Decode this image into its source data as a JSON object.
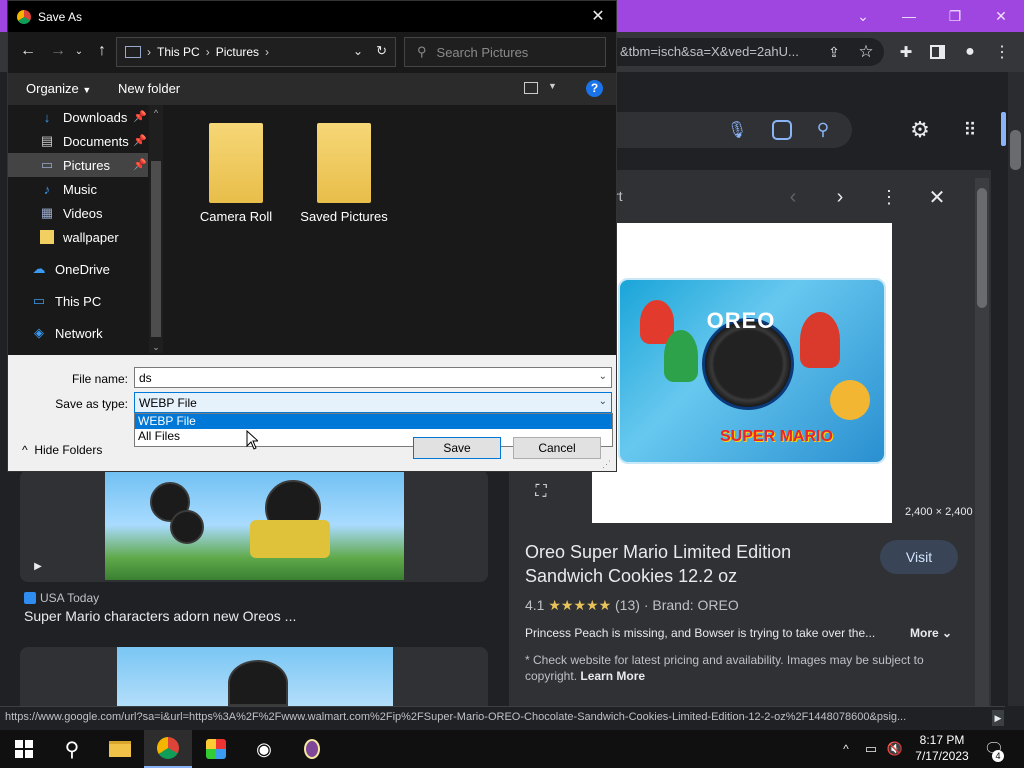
{
  "browser": {
    "omnibox_text": "&tbm=isch&sa=X&ved=2ahU...",
    "status_url": "https://www.google.com/url?sa=i&url=https%3A%2F%2Fwww.walmart.com%2Fip%2FSuper-Mario-OREO-Chocolate-Sandwich-Cookies-Limited-Edition-12-2-oz%2F1448078600&psig..."
  },
  "panel": {
    "header_partial": "rt",
    "image_size": "2,400 × 2,400",
    "product_title": "Oreo Super Mario Limited Edition Sandwich Cookies 12.2 oz",
    "visit_label": "Visit",
    "rating": "4.1",
    "stars": "★★★★★",
    "rating_count": "(13)",
    "brand": "Brand: OREO",
    "description": "Princess Peach is missing, and Bowser is trying to take over the...",
    "more_label": "More",
    "disclaimer": "* Check website for latest pricing and availability. Images may be subject to copyright.",
    "learn_more": "Learn More",
    "pack_logo": "OREO",
    "pack_subtitle": "SUPER MARIO"
  },
  "results": {
    "source": "USA Today",
    "caption": "Super Mario characters adorn new Oreos ..."
  },
  "dialog": {
    "title": "Save As",
    "breadcrumb": [
      "This PC",
      "Pictures"
    ],
    "search_placeholder": "Search Pictures",
    "organize_label": "Organize",
    "new_folder_label": "New folder",
    "nav_items": [
      "Downloads",
      "Documents",
      "Pictures",
      "Music",
      "Videos",
      "wallpaper",
      "OneDrive",
      "This PC",
      "Network"
    ],
    "folders": [
      "Camera Roll",
      "Saved Pictures"
    ],
    "file_name_label": "File name:",
    "file_name_value": "ds",
    "save_type_label": "Save as type:",
    "save_type_value": "WEBP File",
    "type_options": [
      "WEBP File",
      "All Files"
    ],
    "hide_folders_label": "Hide Folders",
    "save_label": "Save",
    "cancel_label": "Cancel"
  },
  "taskbar": {
    "time": "8:17 PM",
    "date": "7/17/2023",
    "notification_count": "4"
  }
}
